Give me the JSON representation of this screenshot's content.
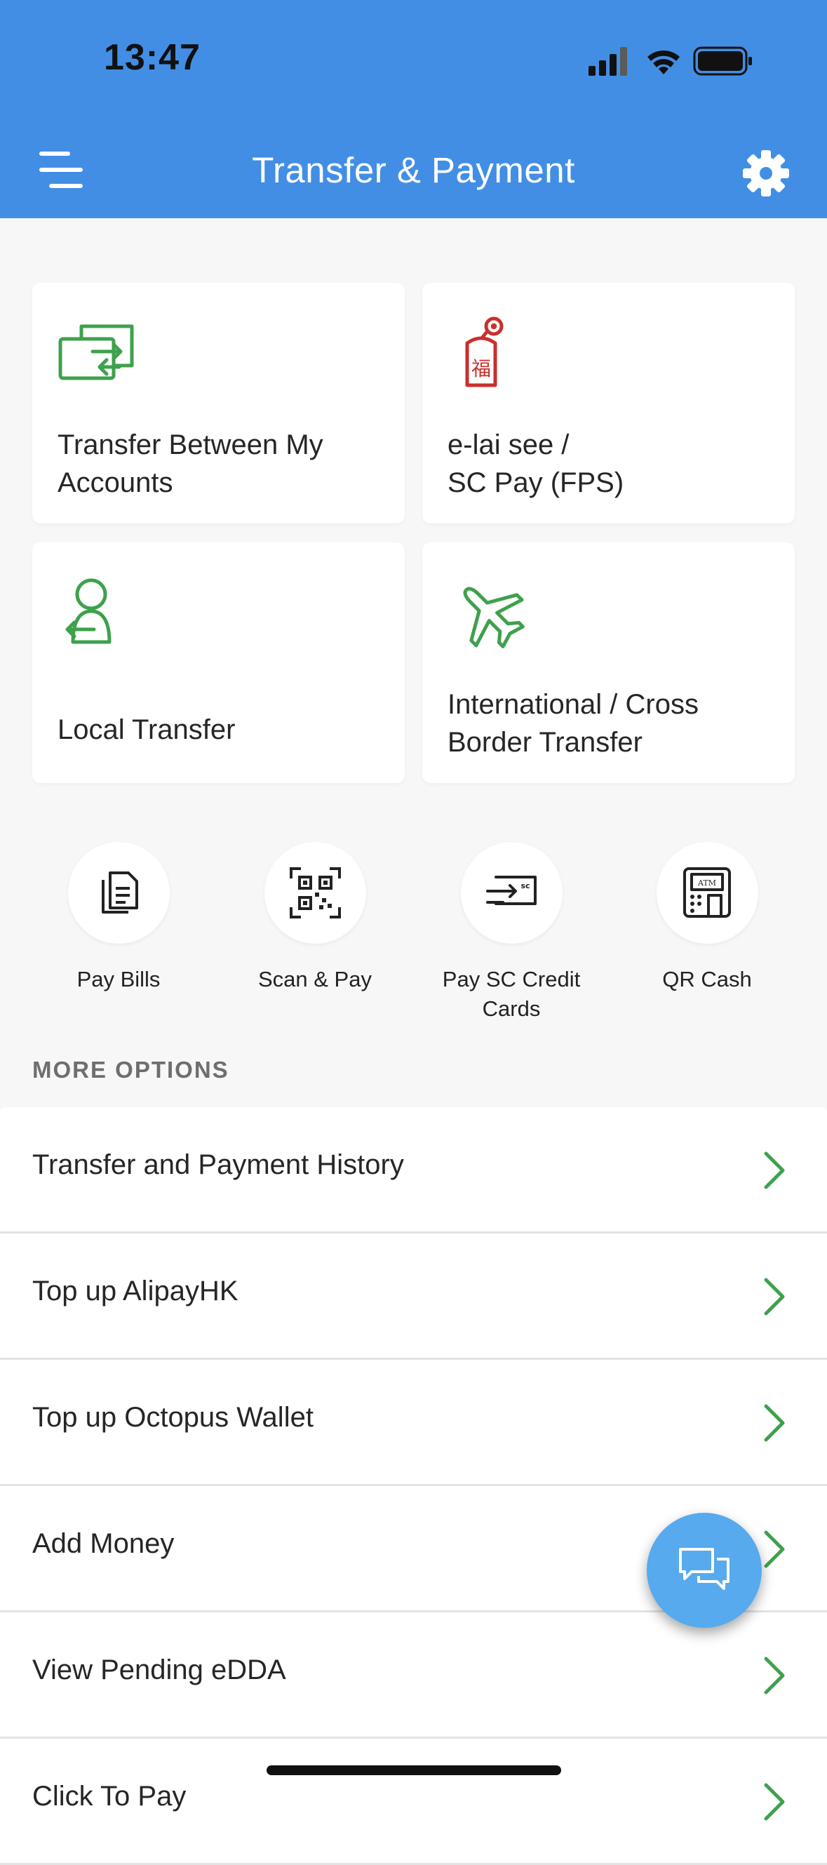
{
  "status_bar": {
    "time": "13:47"
  },
  "header": {
    "title": "Transfer & Payment"
  },
  "tiles": [
    {
      "label": "Transfer Between My\nAccounts",
      "icon": "transfer-arrows-icon"
    },
    {
      "label": "e-lai see /\nSC Pay (FPS)",
      "icon": "red-packet-icon"
    },
    {
      "label": "Local Transfer",
      "icon": "person-transfer-icon"
    },
    {
      "label": "International / Cross\nBorder Transfer",
      "icon": "airplane-icon"
    }
  ],
  "quick_actions": [
    {
      "label": "Pay Bills",
      "icon": "bills-icon"
    },
    {
      "label": "Scan & Pay",
      "icon": "qr-scan-icon"
    },
    {
      "label": "Pay SC Credit\nCards",
      "icon": "credit-card-icon"
    },
    {
      "label": "QR Cash",
      "icon": "atm-icon"
    }
  ],
  "more_options": {
    "title": "MORE OPTIONS",
    "items": [
      "Transfer and Payment History",
      "Top up AlipayHK",
      "Top up Octopus Wallet",
      "Add Money",
      "View Pending eDDA",
      "Click To Pay"
    ]
  },
  "colors": {
    "header": "#428ee4",
    "accent_green": "#3ea14c",
    "accent_red": "#c9302c",
    "fab": "#56aaed"
  }
}
